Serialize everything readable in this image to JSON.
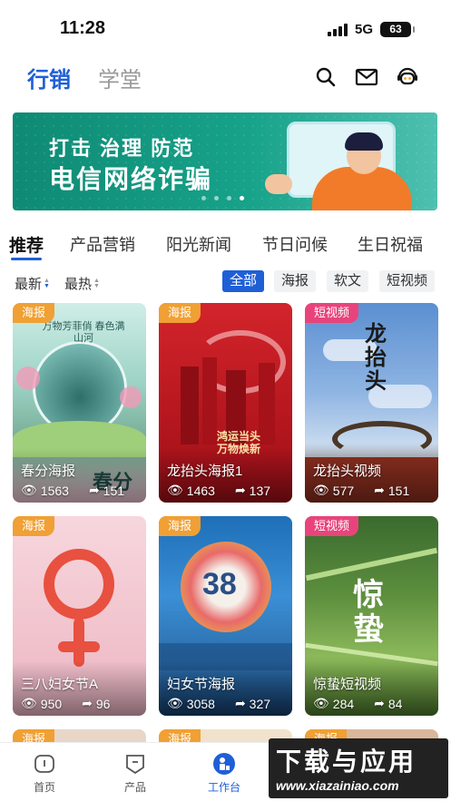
{
  "status": {
    "time": "11:28",
    "network": "5G",
    "battery": "63"
  },
  "header": {
    "tab_active": "行销",
    "tab_inactive": "学堂"
  },
  "banner": {
    "line1": "打击 治理 防范",
    "line2": "电信网络诈骗",
    "dots": 4,
    "active_dot": 4
  },
  "categories": [
    "推荐",
    "产品营销",
    "阳光新闻",
    "节日问候",
    "生日祝福"
  ],
  "sort": {
    "latest": "最新",
    "hottest": "最热"
  },
  "chips": [
    "全部",
    "海报",
    "软文",
    "短视频"
  ],
  "cards": [
    {
      "badge": "海报",
      "title": "春分海报",
      "views": "1563",
      "shares": "151",
      "overlay": "春分",
      "subtitle_art": "万物芳菲俏 春色满山河"
    },
    {
      "badge": "海报",
      "title": "龙抬头海报1",
      "views": "1463",
      "shares": "137",
      "overlay": "鸿运当头 万物焕新"
    },
    {
      "badge": "短视频",
      "title": "龙抬头视频",
      "views": "577",
      "shares": "151",
      "overlay": "龙抬头"
    },
    {
      "badge": "海报",
      "title": "三八妇女节A",
      "views": "950",
      "shares": "96",
      "overlay": ""
    },
    {
      "badge": "海报",
      "title": "妇女节海报",
      "views": "3058",
      "shares": "327",
      "overlay": "38"
    },
    {
      "badge": "短视频",
      "title": "惊蛰短视频",
      "views": "284",
      "shares": "84",
      "overlay": "惊蛰"
    },
    {
      "badge": "海报",
      "title": "",
      "views": "",
      "shares": ""
    },
    {
      "badge": "海报",
      "title": "",
      "views": "",
      "shares": ""
    },
    {
      "badge": "海报",
      "title": "",
      "views": "",
      "shares": ""
    }
  ],
  "bottom_nav": [
    {
      "label": "首页",
      "icon": "home-icon"
    },
    {
      "label": "产品",
      "icon": "product-icon"
    },
    {
      "label": "工作台",
      "icon": "workbench-icon"
    }
  ],
  "watermark": {
    "title": "下载与应用",
    "url": "www.xiazainiao.com"
  },
  "colors": {
    "accent": "#1f5fd6",
    "poster_badge": "#f0a034",
    "video_badge": "#e8447b"
  }
}
